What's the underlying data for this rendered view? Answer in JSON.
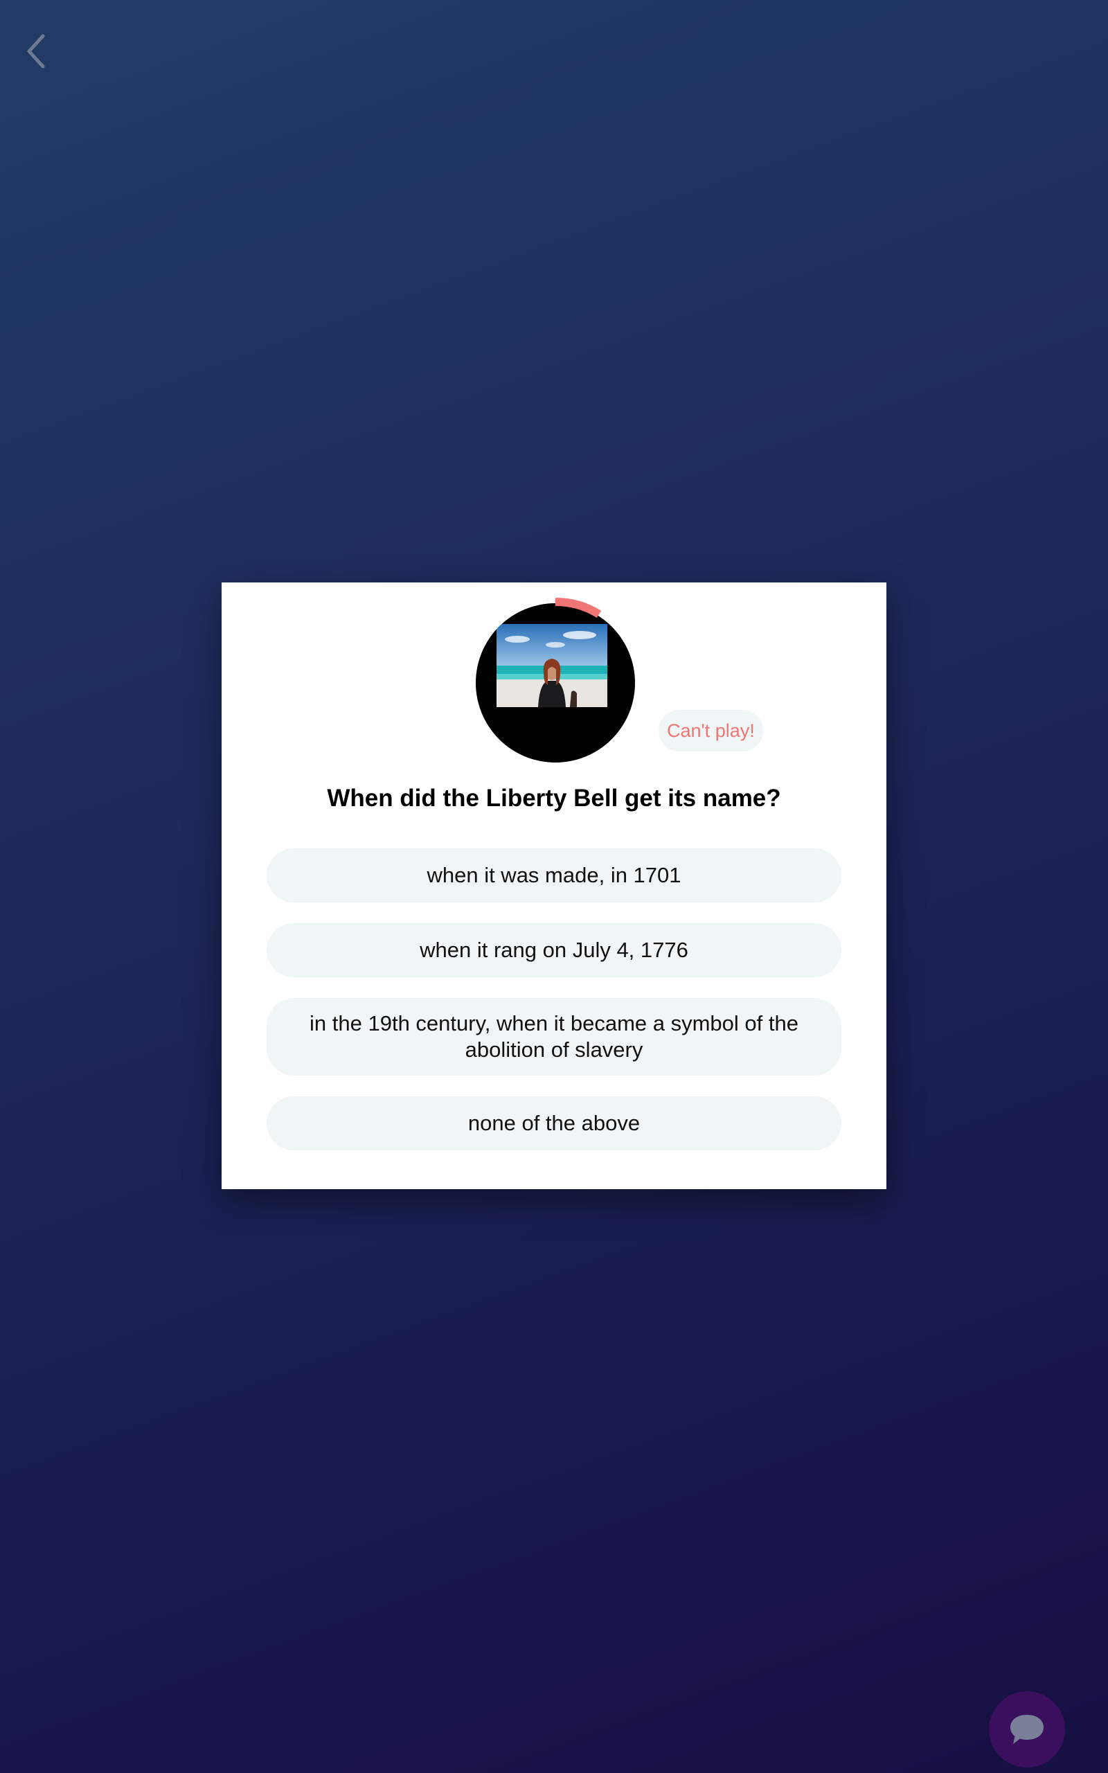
{
  "nav": {
    "back_icon": "chevron-left-icon"
  },
  "video": {
    "thumbnail_icon": "video-thumbnail",
    "timer_color": "#f07575"
  },
  "cant_play_label": "Can't play!",
  "question": "When did the Liberty Bell get its name?",
  "answers": [
    {
      "label": "when it was made, in 1701"
    },
    {
      "label": "when it rang on July 4, 1776"
    },
    {
      "label": "in the 19th century, when it became a symbol of the abolition of slavery"
    },
    {
      "label": "none of the above"
    }
  ],
  "chat": {
    "icon": "chat-bubble-icon",
    "color": "#3a0f5e"
  },
  "colors": {
    "background_top": "#223c66",
    "background_bottom": "#170f42",
    "answer_bg": "#f0f5f5",
    "accent": "#f07575"
  }
}
